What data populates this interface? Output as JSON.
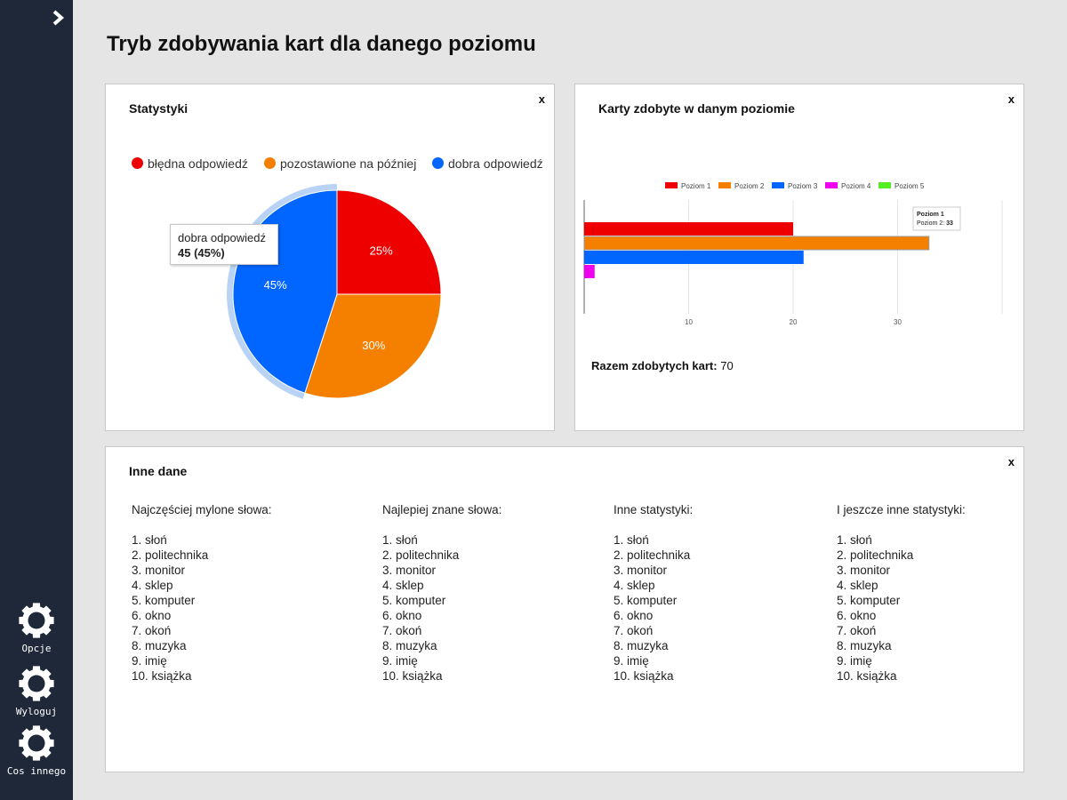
{
  "sidebar": {
    "items": [
      {
        "label": "Opcje",
        "icon": "gear-icon"
      },
      {
        "label": "Wyloguj",
        "icon": "gear-icon"
      },
      {
        "label": "Cos innego",
        "icon": "gear-icon"
      }
    ]
  },
  "page": {
    "title": "Tryb zdobywania kart dla danego poziomu"
  },
  "panels": {
    "stats": {
      "title": "Statystyki",
      "close": "x",
      "legend": [
        "błędna odpowiedź",
        "pozostawione na później",
        "dobra odpowiedź"
      ],
      "tooltip": {
        "title": "dobra odpowiedź",
        "value": "45 (45%)"
      }
    },
    "cards": {
      "title": "Karty zdobyte w danym poziomie",
      "close": "x",
      "total_label": "Razem zdobytych kart:",
      "total_value": "70",
      "tooltip": {
        "title": "Poziom 1",
        "label": "Poziom 2:",
        "value": "33"
      }
    },
    "other": {
      "title": "Inne dane",
      "close": "x",
      "columns": [
        {
          "heading": "Najczęściej mylone słowa:",
          "items": [
            "1. słoń",
            "2. politechnika",
            "3. monitor",
            "4. sklep",
            "5. komputer",
            "6. okno",
            "7. okoń",
            "8. muzyka",
            "9. imię",
            "10. książka"
          ]
        },
        {
          "heading": "Najlepiej znane słowa:",
          "items": [
            "1. słoń",
            "2. politechnika",
            "3. monitor",
            "4. sklep",
            "5. komputer",
            "6. okno",
            "7. okoń",
            "8. muzyka",
            "9. imię",
            "10. książka"
          ]
        },
        {
          "heading": "Inne statystyki:",
          "items": [
            "1. słoń",
            "2. politechnika",
            "3. monitor",
            "4. sklep",
            "5. komputer",
            "6. okno",
            "7. okoń",
            "8. muzyka",
            "9. imię",
            "10. książka"
          ]
        },
        {
          "heading": "I jeszcze inne statystyki:",
          "items": [
            "1. słoń",
            "2. politechnika",
            "3. monitor",
            "4. sklep",
            "5. komputer",
            "6. okno",
            "7. okoń",
            "8. muzyka",
            "9. imię",
            "10. książka"
          ]
        }
      ]
    }
  },
  "colors": {
    "sidebar_bg": "#1e2838",
    "red": "#ee0000",
    "orange": "#f58000",
    "blue": "#0066ff",
    "magenta": "#ee00ee",
    "green": "#55ee22"
  },
  "chart_data": [
    {
      "type": "pie",
      "labels": [
        "błędna odpowiedź",
        "pozostawione na później",
        "dobra odpowiedź"
      ],
      "values": [
        25,
        30,
        45
      ],
      "slice_labels": [
        "25%",
        "30%",
        "45%"
      ],
      "colors": [
        "#ee0000",
        "#f58000",
        "#0066ff"
      ],
      "highlighted": "dobra odpowiedź",
      "title": "Statystyki",
      "legend": "top"
    },
    {
      "type": "bar",
      "orientation": "horizontal",
      "series": [
        {
          "name": "Poziom 1",
          "value": 20,
          "color": "#ee0000"
        },
        {
          "name": "Poziom 2",
          "value": 33,
          "color": "#f58000"
        },
        {
          "name": "Poziom 3",
          "value": 21,
          "color": "#0066ff"
        },
        {
          "name": "Poziom 4",
          "value": 1,
          "color": "#ee00ee"
        },
        {
          "name": "Poziom 5",
          "value": 0,
          "color": "#55ee22"
        }
      ],
      "xticks": [
        "10",
        "20",
        "30"
      ],
      "xlim": [
        0,
        40
      ],
      "grid": true,
      "legend": "top",
      "title": "Karty zdobyte w danym poziomie"
    }
  ]
}
